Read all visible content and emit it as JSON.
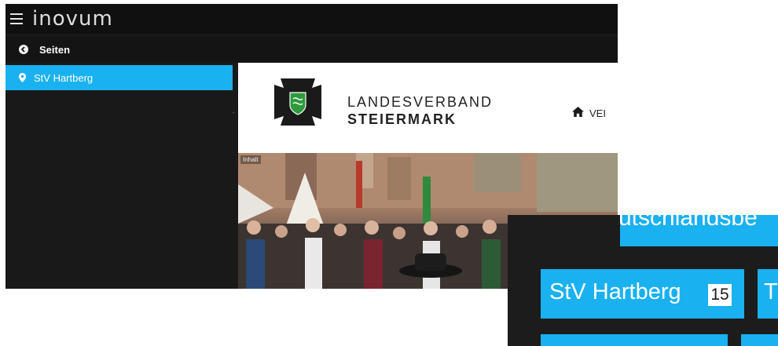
{
  "app": {
    "brand": "inovum",
    "pages_title": "Seiten",
    "sidebar_active": "StV Hartberg"
  },
  "preview": {
    "site_name_line1": "LANDESVERBAND",
    "site_name_line2": "STEIERMARK",
    "nav_first": "VEI",
    "content_tag": "Inhalt"
  },
  "zoom": {
    "strip_text": "utschlandsbe",
    "tile1_label": "StV Hartberg",
    "tile1_count": "15",
    "tile2_label": "T"
  },
  "colors": {
    "accent": "#1ab1f0",
    "topbar": "#101010",
    "panel": "#191919"
  }
}
